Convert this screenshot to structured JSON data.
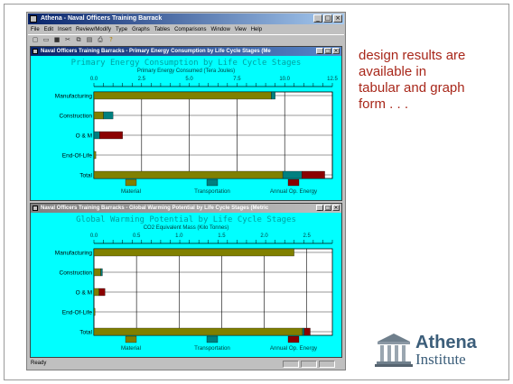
{
  "app": {
    "title": "Athena - Naval Officers Training Barrack",
    "menu": [
      "File",
      "Edit",
      "Insert",
      "Review/Modify",
      "Type",
      "Graphs",
      "Tables",
      "Comparisons",
      "Window",
      "View",
      "Help"
    ],
    "toolbar_icons": [
      "new-icon",
      "open-icon",
      "save-icon",
      "cut-icon",
      "copy-icon",
      "paste-icon",
      "print-icon",
      "help-icon"
    ],
    "status": "Ready"
  },
  "windows": [
    {
      "title": "Naval Officers Training Barracks - Primary Energy Consumption by Life Cycle Stages (Me",
      "active": true
    },
    {
      "title": "Naval Officers Training Barracks - Global Warming Potential by Life Cycle Stages (Metric",
      "active": false
    }
  ],
  "chart_data": [
    {
      "type": "bar",
      "orientation": "horizontal",
      "stacked": true,
      "title": "Primary Energy Consumption by Life Cycle Stages",
      "subtitle": "Primary Energy Consumed (Tera Joules)",
      "categories": [
        "Manufacturing",
        "Construction",
        "O & M",
        "End-Of-Life",
        "Total"
      ],
      "series": [
        {
          "name": "Material",
          "color": "#808000",
          "values": [
            9.3,
            0.5,
            0,
            0.1,
            9.9
          ]
        },
        {
          "name": "Transportation",
          "color": "#008080",
          "values": [
            0.2,
            0.5,
            0.3,
            0,
            1.0
          ]
        },
        {
          "name": "Annual Op. Energy",
          "color": "#8b0000",
          "values": [
            0,
            0,
            1.2,
            0,
            1.2
          ]
        }
      ],
      "xticks": [
        "0.0",
        "2.5",
        "5.0",
        "7.5",
        "10.0",
        "12.5"
      ],
      "xlim": [
        0,
        12.5
      ],
      "grid": true,
      "legend": "bottom"
    },
    {
      "type": "bar",
      "orientation": "horizontal",
      "stacked": true,
      "title": "Global Warming Potential by Life Cycle Stages",
      "subtitle": "CO2 Equivalent Mass (Kilo Tonnes)",
      "categories": [
        "Manufacturing",
        "Construction",
        "O & M",
        "End-Of-Life",
        "Total"
      ],
      "series": [
        {
          "name": "Material",
          "color": "#808000",
          "values": [
            2.35,
            0.08,
            0.06,
            0.01,
            2.45
          ]
        },
        {
          "name": "Transportation",
          "color": "#008080",
          "values": [
            0.0,
            0.02,
            0.0,
            0.0,
            0.02
          ]
        },
        {
          "name": "Annual Op. Energy",
          "color": "#8b0000",
          "values": [
            0,
            0,
            0.07,
            0,
            0.07
          ]
        }
      ],
      "xticks": [
        "0.0",
        "0.5",
        "1.0",
        "1.5",
        "2.0",
        "2.5"
      ],
      "xlim": [
        0,
        2.8
      ],
      "grid": true,
      "legend": "bottom"
    }
  ],
  "caption": [
    "design results are",
    "available in",
    "tabular and graph",
    "form . . ."
  ],
  "logo": {
    "line1": "Athena",
    "line2": "Institute"
  }
}
